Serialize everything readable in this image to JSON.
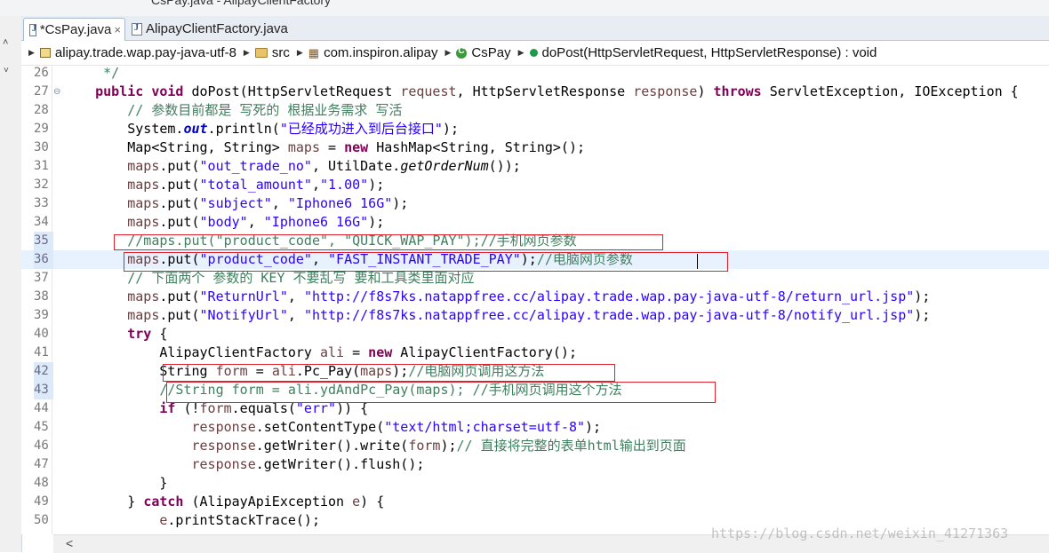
{
  "window": {
    "partial_title": "CsPay.java - AlipayClientFactory"
  },
  "sidebar": {
    "chevron_up": "˄",
    "chevron_down": "˅"
  },
  "tabs": [
    {
      "label": "*CsPay.java",
      "close": "×",
      "active": true
    },
    {
      "label": "AlipayClientFactory.java",
      "active": false
    }
  ],
  "breadcrumb": [
    {
      "label": "alipay.trade.wap.pay-java-utf-8",
      "icon": "project-icon"
    },
    {
      "label": "src",
      "icon": "source-folder-icon"
    },
    {
      "label": "com.inspiron.alipay",
      "icon": "package-icon"
    },
    {
      "label": "CsPay",
      "icon": "class-icon"
    },
    {
      "label": "doPost(HttpServletRequest, HttpServletResponse) : void",
      "icon": "method-icon"
    }
  ],
  "editor": {
    "current_line": "36",
    "lines": [
      {
        "n": "26",
        "tokens": [
          {
            "t": "     */",
            "c": "cm"
          }
        ]
      },
      {
        "n": "27",
        "fold": "⊖",
        "tokens": [
          {
            "t": "    "
          },
          {
            "t": "public",
            "c": "kw"
          },
          {
            "t": " "
          },
          {
            "t": "void",
            "c": "kw"
          },
          {
            "t": " doPost(HttpServletRequest "
          },
          {
            "t": "request",
            "c": "par"
          },
          {
            "t": ", HttpServletResponse "
          },
          {
            "t": "response",
            "c": "par"
          },
          {
            "t": ") "
          },
          {
            "t": "throws",
            "c": "kw"
          },
          {
            "t": " ServletException, IOException {"
          }
        ]
      },
      {
        "n": "28",
        "tokens": [
          {
            "t": "        // 参数目前都是 写死的 根据业务需求 写活",
            "c": "cm"
          }
        ]
      },
      {
        "n": "29",
        "tokens": [
          {
            "t": "        System."
          },
          {
            "t": "out",
            "c": "fld"
          },
          {
            "t": ".println("
          },
          {
            "t": "\"已经成功进入到后台接口\"",
            "c": "str"
          },
          {
            "t": ");"
          }
        ]
      },
      {
        "n": "30",
        "tokens": [
          {
            "t": "        Map<String, String> "
          },
          {
            "t": "maps",
            "c": "lv"
          },
          {
            "t": " = "
          },
          {
            "t": "new",
            "c": "kw"
          },
          {
            "t": " HashMap<String, String>();"
          }
        ]
      },
      {
        "n": "31",
        "tokens": [
          {
            "t": "        "
          },
          {
            "t": "maps",
            "c": "lv"
          },
          {
            "t": ".put("
          },
          {
            "t": "\"out_trade_no\"",
            "c": "str"
          },
          {
            "t": ", UtilDate."
          },
          {
            "t": "getOrderNum",
            "c": "sm"
          },
          {
            "t": "());"
          }
        ]
      },
      {
        "n": "32",
        "tokens": [
          {
            "t": "        "
          },
          {
            "t": "maps",
            "c": "lv"
          },
          {
            "t": ".put("
          },
          {
            "t": "\"total_amount\"",
            "c": "str"
          },
          {
            "t": ","
          },
          {
            "t": "\"1.00\"",
            "c": "str"
          },
          {
            "t": ");"
          }
        ]
      },
      {
        "n": "33",
        "tokens": [
          {
            "t": "        "
          },
          {
            "t": "maps",
            "c": "lv"
          },
          {
            "t": ".put("
          },
          {
            "t": "\"subject\"",
            "c": "str"
          },
          {
            "t": ", "
          },
          {
            "t": "\"Iphone6 16G\"",
            "c": "str"
          },
          {
            "t": ");"
          }
        ]
      },
      {
        "n": "34",
        "tokens": [
          {
            "t": "        "
          },
          {
            "t": "maps",
            "c": "lv"
          },
          {
            "t": ".put("
          },
          {
            "t": "\"body\"",
            "c": "str"
          },
          {
            "t": ", "
          },
          {
            "t": "\"Iphone6 16G\"",
            "c": "str"
          },
          {
            "t": ");"
          }
        ]
      },
      {
        "n": "35",
        "changed": true,
        "tokens": [
          {
            "t": "        //maps.put(\"product_code\", \"QUICK_WAP_PAY\");//手机网页参数",
            "c": "cm"
          }
        ]
      },
      {
        "n": "36",
        "changed": true,
        "tokens": [
          {
            "t": "        "
          },
          {
            "t": "maps",
            "c": "lv"
          },
          {
            "t": ".put("
          },
          {
            "t": "\"product_code\"",
            "c": "str"
          },
          {
            "t": ", "
          },
          {
            "t": "\"FAST_INSTANT_TRADE_PAY\"",
            "c": "str"
          },
          {
            "t": ");"
          },
          {
            "t": "//电脑网页参数",
            "c": "cm"
          }
        ]
      },
      {
        "n": "37",
        "tokens": [
          {
            "t": "        // 下面两个 参数的 KEY 不要乱写 要和工具类里面对应",
            "c": "cm"
          }
        ]
      },
      {
        "n": "38",
        "tokens": [
          {
            "t": "        "
          },
          {
            "t": "maps",
            "c": "lv"
          },
          {
            "t": ".put("
          },
          {
            "t": "\"ReturnUrl\"",
            "c": "str"
          },
          {
            "t": ", "
          },
          {
            "t": "\"http://f8s7ks.natappfree.cc/alipay.trade.wap.pay-java-utf-8/return_url.jsp\"",
            "c": "str"
          },
          {
            "t": ");"
          }
        ]
      },
      {
        "n": "39",
        "tokens": [
          {
            "t": "        "
          },
          {
            "t": "maps",
            "c": "lv"
          },
          {
            "t": ".put("
          },
          {
            "t": "\"NotifyUrl\"",
            "c": "str"
          },
          {
            "t": ", "
          },
          {
            "t": "\"http://f8s7ks.natappfree.cc/alipay.trade.wap.pay-java-utf-8/notify_url.jsp\"",
            "c": "str"
          },
          {
            "t": ");"
          }
        ]
      },
      {
        "n": "40",
        "tokens": [
          {
            "t": "        "
          },
          {
            "t": "try",
            "c": "kw"
          },
          {
            "t": " {"
          }
        ]
      },
      {
        "n": "41",
        "tokens": [
          {
            "t": "            AlipayClientFactory "
          },
          {
            "t": "ali",
            "c": "lv"
          },
          {
            "t": " = "
          },
          {
            "t": "new",
            "c": "kw"
          },
          {
            "t": " AlipayClientFactory();"
          }
        ]
      },
      {
        "n": "42",
        "changed": true,
        "tokens": [
          {
            "t": "            String "
          },
          {
            "t": "form",
            "c": "lv"
          },
          {
            "t": " = "
          },
          {
            "t": "ali",
            "c": "lv"
          },
          {
            "t": ".Pc_Pay("
          },
          {
            "t": "maps",
            "c": "lv"
          },
          {
            "t": ");"
          },
          {
            "t": "//电脑网页调用这方法",
            "c": "cm"
          }
        ]
      },
      {
        "n": "43",
        "changed": true,
        "tokens": [
          {
            "t": "            //String form = ali.ydAndPc_Pay(maps); //手机网页调用这个方法",
            "c": "cm"
          }
        ]
      },
      {
        "n": "44",
        "tokens": [
          {
            "t": "            "
          },
          {
            "t": "if",
            "c": "kw"
          },
          {
            "t": " (!"
          },
          {
            "t": "form",
            "c": "lv"
          },
          {
            "t": ".equals("
          },
          {
            "t": "\"err\"",
            "c": "str"
          },
          {
            "t": ")) {"
          }
        ]
      },
      {
        "n": "45",
        "tokens": [
          {
            "t": "                "
          },
          {
            "t": "response",
            "c": "par"
          },
          {
            "t": ".setContentType("
          },
          {
            "t": "\"text/html;charset=utf-8\"",
            "c": "str"
          },
          {
            "t": ");"
          }
        ]
      },
      {
        "n": "46",
        "tokens": [
          {
            "t": "                "
          },
          {
            "t": "response",
            "c": "par"
          },
          {
            "t": ".getWriter().write("
          },
          {
            "t": "form",
            "c": "lv"
          },
          {
            "t": ");"
          },
          {
            "t": "// 直接将完整的表单html输出到页面",
            "c": "cm"
          }
        ]
      },
      {
        "n": "47",
        "tokens": [
          {
            "t": "                "
          },
          {
            "t": "response",
            "c": "par"
          },
          {
            "t": ".getWriter().flush();"
          }
        ]
      },
      {
        "n": "48",
        "tokens": [
          {
            "t": "            }"
          }
        ]
      },
      {
        "n": "49",
        "tokens": [
          {
            "t": "        } "
          },
          {
            "t": "catch",
            "c": "kw"
          },
          {
            "t": " (AlipayApiException "
          },
          {
            "t": "e",
            "c": "par"
          },
          {
            "t": ") {"
          }
        ]
      },
      {
        "n": "50",
        "tokens": [
          {
            "t": "            "
          },
          {
            "t": "e",
            "c": "par"
          },
          {
            "t": ".printStackTrace();"
          }
        ]
      }
    ]
  },
  "scrollbar": {
    "left_arrow": "<"
  },
  "watermark": "https://blog.csdn.net/weixin_41271363"
}
